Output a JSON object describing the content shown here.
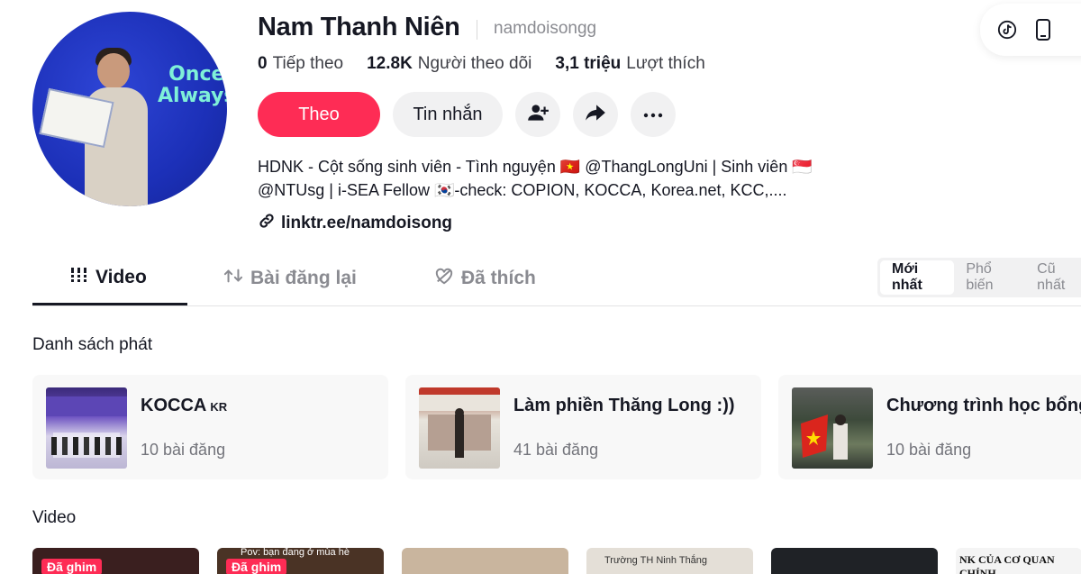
{
  "profile": {
    "display_name": "Nam Thanh Niên",
    "handle": "namdoisongg",
    "avatar_text": "Once\nAlways",
    "stats": [
      {
        "value": "0",
        "label": "Tiếp theo"
      },
      {
        "value": "12.8K",
        "label": "Người theo dõi"
      },
      {
        "value": "3,1 triệu",
        "label": "Lượt thích"
      }
    ],
    "bio_line1": "HDNK - Cột sống sinh viên - Tình nguyện 🇻🇳 @ThangLongUni | Sinh viên 🇸🇬",
    "bio_line2": "@NTUsg | i-SEA Fellow 🇰🇷-check: COPION, KOCCA, Korea.net, KCC,....",
    "link": "linktr.ee/namdoisong"
  },
  "actions": {
    "follow_label": "Theo",
    "message_label": "Tin nhắn"
  },
  "tabs": [
    {
      "label": "Video",
      "active": true
    },
    {
      "label": "Bài đăng lại",
      "active": false
    },
    {
      "label": "Đã thích",
      "active": false
    }
  ],
  "sort_options": [
    {
      "label": "Mới nhất",
      "active": true
    },
    {
      "label": "Phổ biến",
      "active": false
    },
    {
      "label": "Cũ nhất",
      "active": false
    }
  ],
  "playlists_title": "Danh sách phát",
  "playlists": [
    {
      "title": "KOCCA",
      "flag": "KR",
      "count": "10 bài đăng"
    },
    {
      "title": "Làm phiền Thăng Long :))",
      "flag": "",
      "count": "41 bài đăng"
    },
    {
      "title": "Chương trình học bổng",
      "flag": "",
      "count": "10 bài đăng"
    }
  ],
  "videos_title": "Video",
  "videos": [
    {
      "pinned_label": "Đã ghim",
      "caption": ""
    },
    {
      "pinned_label": "Đã ghim",
      "caption": "Pov: bạn đang ở mùa hè"
    },
    {
      "pinned_label": "",
      "caption": ""
    },
    {
      "pinned_label": "",
      "caption": "Trường TH Ninh Thắng"
    },
    {
      "pinned_label": "",
      "caption": ""
    },
    {
      "pinned_label": "",
      "caption": "NK CỦA CƠ QUAN CHÍNH"
    }
  ],
  "colors": {
    "accent": "#fe2c55",
    "button_gray": "#f1f1f2",
    "text_primary": "#161823",
    "text_secondary": "#8a8b91"
  }
}
